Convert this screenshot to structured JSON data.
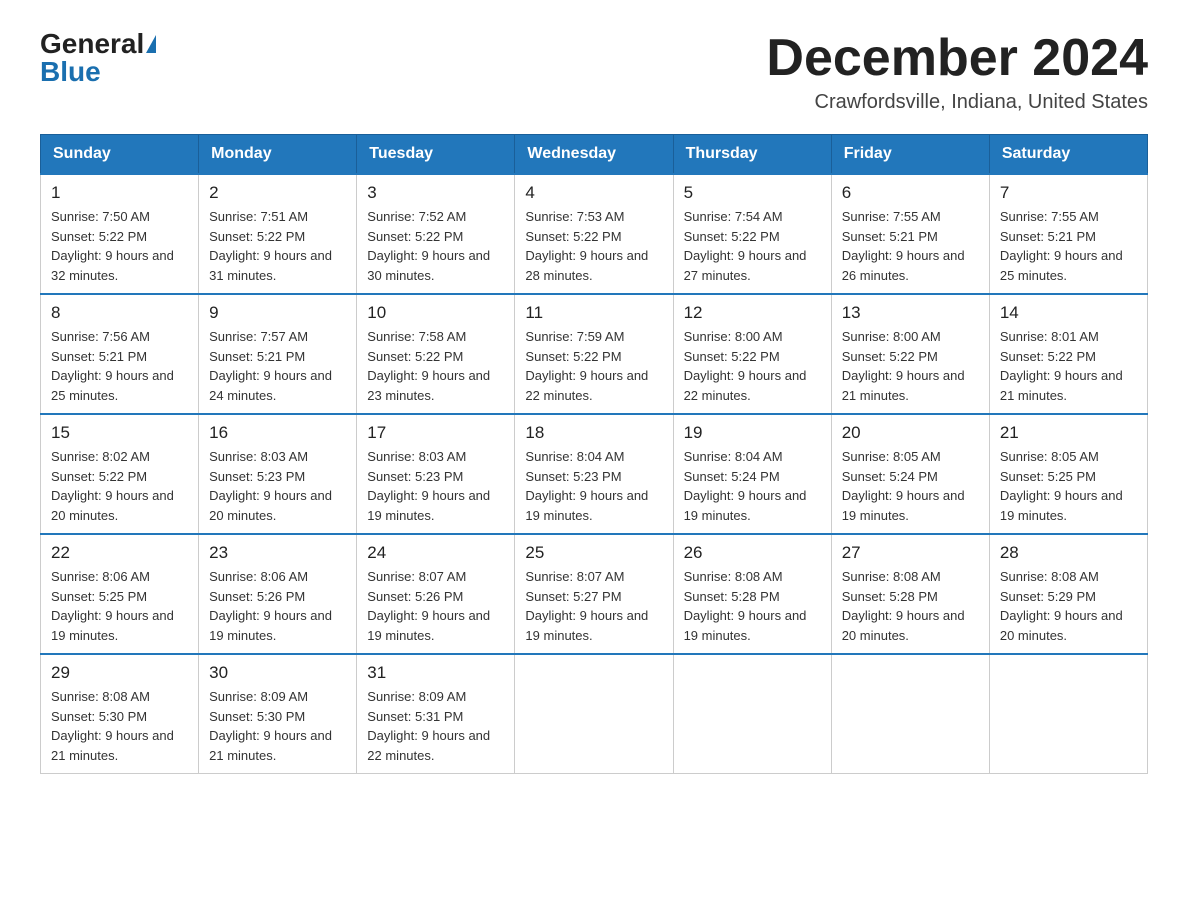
{
  "header": {
    "logo_general": "General",
    "logo_blue": "Blue",
    "month_title": "December 2024",
    "location": "Crawfordsville, Indiana, United States"
  },
  "days_of_week": [
    "Sunday",
    "Monday",
    "Tuesday",
    "Wednesday",
    "Thursday",
    "Friday",
    "Saturday"
  ],
  "weeks": [
    [
      {
        "day": "1",
        "sunrise": "7:50 AM",
        "sunset": "5:22 PM",
        "daylight": "9 hours and 32 minutes."
      },
      {
        "day": "2",
        "sunrise": "7:51 AM",
        "sunset": "5:22 PM",
        "daylight": "9 hours and 31 minutes."
      },
      {
        "day": "3",
        "sunrise": "7:52 AM",
        "sunset": "5:22 PM",
        "daylight": "9 hours and 30 minutes."
      },
      {
        "day": "4",
        "sunrise": "7:53 AM",
        "sunset": "5:22 PM",
        "daylight": "9 hours and 28 minutes."
      },
      {
        "day": "5",
        "sunrise": "7:54 AM",
        "sunset": "5:22 PM",
        "daylight": "9 hours and 27 minutes."
      },
      {
        "day": "6",
        "sunrise": "7:55 AM",
        "sunset": "5:21 PM",
        "daylight": "9 hours and 26 minutes."
      },
      {
        "day": "7",
        "sunrise": "7:55 AM",
        "sunset": "5:21 PM",
        "daylight": "9 hours and 25 minutes."
      }
    ],
    [
      {
        "day": "8",
        "sunrise": "7:56 AM",
        "sunset": "5:21 PM",
        "daylight": "9 hours and 25 minutes."
      },
      {
        "day": "9",
        "sunrise": "7:57 AM",
        "sunset": "5:21 PM",
        "daylight": "9 hours and 24 minutes."
      },
      {
        "day": "10",
        "sunrise": "7:58 AM",
        "sunset": "5:22 PM",
        "daylight": "9 hours and 23 minutes."
      },
      {
        "day": "11",
        "sunrise": "7:59 AM",
        "sunset": "5:22 PM",
        "daylight": "9 hours and 22 minutes."
      },
      {
        "day": "12",
        "sunrise": "8:00 AM",
        "sunset": "5:22 PM",
        "daylight": "9 hours and 22 minutes."
      },
      {
        "day": "13",
        "sunrise": "8:00 AM",
        "sunset": "5:22 PM",
        "daylight": "9 hours and 21 minutes."
      },
      {
        "day": "14",
        "sunrise": "8:01 AM",
        "sunset": "5:22 PM",
        "daylight": "9 hours and 21 minutes."
      }
    ],
    [
      {
        "day": "15",
        "sunrise": "8:02 AM",
        "sunset": "5:22 PM",
        "daylight": "9 hours and 20 minutes."
      },
      {
        "day": "16",
        "sunrise": "8:03 AM",
        "sunset": "5:23 PM",
        "daylight": "9 hours and 20 minutes."
      },
      {
        "day": "17",
        "sunrise": "8:03 AM",
        "sunset": "5:23 PM",
        "daylight": "9 hours and 19 minutes."
      },
      {
        "day": "18",
        "sunrise": "8:04 AM",
        "sunset": "5:23 PM",
        "daylight": "9 hours and 19 minutes."
      },
      {
        "day": "19",
        "sunrise": "8:04 AM",
        "sunset": "5:24 PM",
        "daylight": "9 hours and 19 minutes."
      },
      {
        "day": "20",
        "sunrise": "8:05 AM",
        "sunset": "5:24 PM",
        "daylight": "9 hours and 19 minutes."
      },
      {
        "day": "21",
        "sunrise": "8:05 AM",
        "sunset": "5:25 PM",
        "daylight": "9 hours and 19 minutes."
      }
    ],
    [
      {
        "day": "22",
        "sunrise": "8:06 AM",
        "sunset": "5:25 PM",
        "daylight": "9 hours and 19 minutes."
      },
      {
        "day": "23",
        "sunrise": "8:06 AM",
        "sunset": "5:26 PM",
        "daylight": "9 hours and 19 minutes."
      },
      {
        "day": "24",
        "sunrise": "8:07 AM",
        "sunset": "5:26 PM",
        "daylight": "9 hours and 19 minutes."
      },
      {
        "day": "25",
        "sunrise": "8:07 AM",
        "sunset": "5:27 PM",
        "daylight": "9 hours and 19 minutes."
      },
      {
        "day": "26",
        "sunrise": "8:08 AM",
        "sunset": "5:28 PM",
        "daylight": "9 hours and 19 minutes."
      },
      {
        "day": "27",
        "sunrise": "8:08 AM",
        "sunset": "5:28 PM",
        "daylight": "9 hours and 20 minutes."
      },
      {
        "day": "28",
        "sunrise": "8:08 AM",
        "sunset": "5:29 PM",
        "daylight": "9 hours and 20 minutes."
      }
    ],
    [
      {
        "day": "29",
        "sunrise": "8:08 AM",
        "sunset": "5:30 PM",
        "daylight": "9 hours and 21 minutes."
      },
      {
        "day": "30",
        "sunrise": "8:09 AM",
        "sunset": "5:30 PM",
        "daylight": "9 hours and 21 minutes."
      },
      {
        "day": "31",
        "sunrise": "8:09 AM",
        "sunset": "5:31 PM",
        "daylight": "9 hours and 22 minutes."
      },
      null,
      null,
      null,
      null
    ]
  ]
}
